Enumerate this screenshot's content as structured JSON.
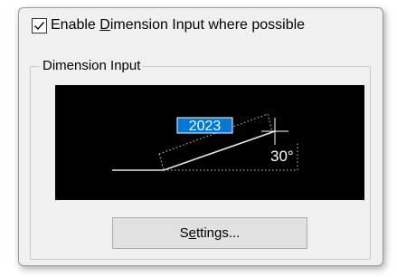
{
  "option": {
    "checked": true,
    "label_pre": "Enable ",
    "label_mnemonic": "D",
    "label_post": "imension Input where possible"
  },
  "group": {
    "title": "Dimension Input"
  },
  "preview": {
    "length_value": "2023",
    "angle_value": "30°"
  },
  "settings_button": {
    "label_pre": "S",
    "label_mnemonic": "e",
    "label_post": "ttings..."
  },
  "colors": {
    "highlight": "#0078d7",
    "preview_bg": "#000000"
  }
}
